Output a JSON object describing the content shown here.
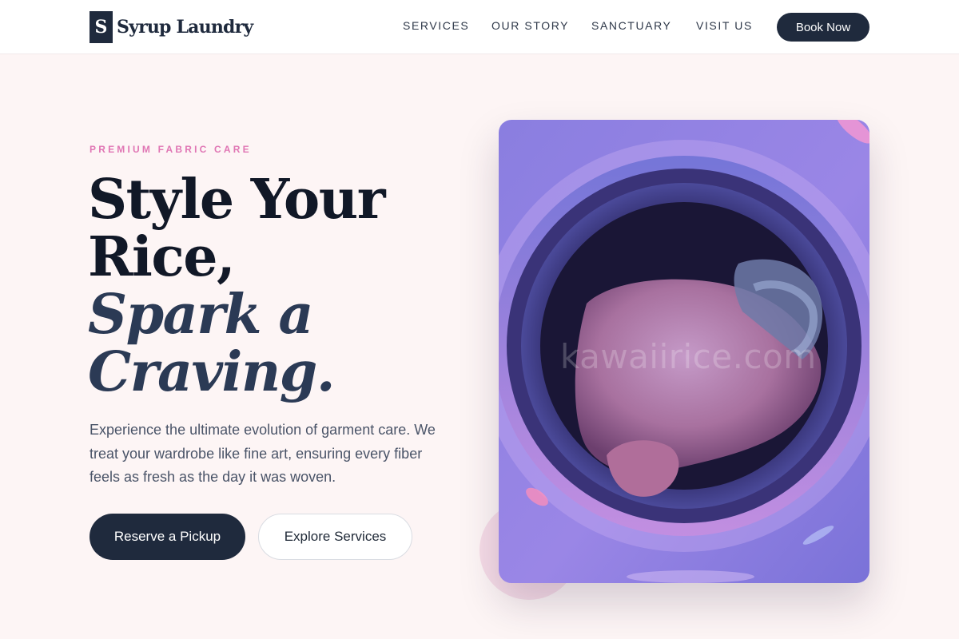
{
  "brand": {
    "mark": "S",
    "name": "Syrup Laundry"
  },
  "nav": {
    "items": [
      {
        "label": "SERVICES"
      },
      {
        "label": "OUR STORY"
      },
      {
        "label": "SANCTUARY"
      },
      {
        "label": "VISIT US"
      }
    ],
    "cta_label": "Book Now"
  },
  "hero": {
    "eyebrow": "PREMIUM FABRIC CARE",
    "headline": {
      "line1": "Style Your",
      "line2": "Rice,",
      "line3": "Spark a",
      "line4": "Craving."
    },
    "lede": "Experience the ultimate evolution of garment care. We treat your wardrobe like fine art, ensuring every fiber feels as fresh as the day it was woven.",
    "primary_cta": "Reserve a Pickup",
    "secondary_cta": "Explore Services",
    "image_watermark": "kawaiirice.com"
  },
  "colors": {
    "navy": "#1f2a3d",
    "accent_pink": "#e076b4",
    "page_background": "#fdf5f5"
  },
  "icons": {
    "hero_image": "washing-machine-drum-photo"
  }
}
